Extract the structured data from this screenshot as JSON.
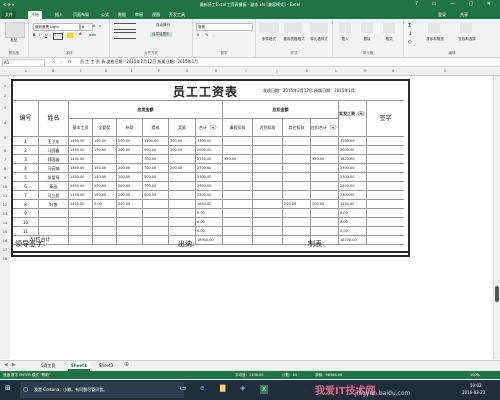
{
  "window": {
    "title": "最新员工Excel工资表模板 - 副本.xls [兼容模式] - Excel",
    "controls": "? ▭ — ▢ ✕"
  },
  "quick_access": "⟲ ⟳ ▾",
  "menu": {
    "tabs": [
      "文件",
      "开始",
      "插入",
      "页面布局",
      "公式",
      "数据",
      "审阅",
      "视图",
      "开发工具"
    ],
    "active": "开始",
    "right": [
      "登录",
      "共享"
    ]
  },
  "ribbon": {
    "clipboard": {
      "label": "剪贴板",
      "paste": "粘贴"
    },
    "font": {
      "label": "字体",
      "name": "微软雅黑 Light",
      "size": "8",
      "bold": "B",
      "italic": "I",
      "underline": "U",
      "grow": "A",
      "shrink": "A",
      "wen": "wén"
    },
    "align": {
      "label": "对齐方式",
      "wrap": "自动换行",
      "merge": "合并后居中"
    },
    "number": {
      "label": "数字",
      "format": "常规",
      "percent": "%",
      "comma": ","
    },
    "styles": {
      "label": "样式",
      "cond": "条件格式",
      "table": "套用表格格式",
      "cell": "单元格样式"
    },
    "cells": {
      "label": "单元格",
      "insert": "插入",
      "delete": "删除",
      "format": "格式"
    },
    "edit": {
      "label": "编辑",
      "sort": "排序和筛选",
      "find": "查找和选择"
    }
  },
  "formula_bar": {
    "name_box": "A1",
    "fx": "fx",
    "value": "员 工 工 资 表   发放日期：2015年2月12日  所属日期：2015年1月"
  },
  "columns": [
    "A",
    "B",
    "C",
    "D",
    "E",
    "F",
    "G",
    "H",
    "I",
    "J",
    "K",
    "L",
    "M",
    "N",
    "O"
  ],
  "rows": [
    "1",
    "2",
    "3",
    "4",
    "5",
    "6",
    "7",
    "8",
    "9",
    "10",
    "11",
    "12",
    "13",
    "14",
    "15",
    "16",
    "17",
    "18"
  ],
  "sheet": {
    "title": "员工工资表",
    "date_text": "发放日期：2015年2月12日 所属日期：2015年1月",
    "hdr_no": "编号",
    "hdr_name": "姓名",
    "hdr_payable": "应发金额",
    "hdr_deduct": "应扣金额",
    "hdr_actual": "实发工资（元）",
    "hdr_sign": "签字",
    "sub_payable": [
      "基本工资",
      "全勤奖",
      "补助",
      "提成",
      "奖励",
      "合计（元）"
    ],
    "sub_deduct": [
      "事假扣款",
      "迟到扣款",
      "其它扣款",
      "应扣合计（元）"
    ],
    "rows": [
      {
        "no": "1",
        "name": "王卫东",
        "v": [
          "1450.00",
          "150.00",
          "200.00",
          "1200.00",
          "300.00",
          "3300.00",
          "",
          "",
          "",
          "",
          "3300.00"
        ]
      },
      {
        "no": "2",
        "name": "马国鑫",
        "v": [
          "1450.00",
          "150.00",
          "200.00",
          "900.00",
          "300.00",
          "3000.00",
          "",
          "",
          "",
          "",
          "3000.00"
        ]
      },
      {
        "no": "3",
        "name": "郑国坡",
        "v": [
          "1450.00",
          "",
          "",
          "700.00",
          "",
          "2150.00",
          "330.00",
          "",
          "",
          "330.00",
          "1820.00"
        ]
      },
      {
        "no": "4",
        "name": "马云城",
        "v": [
          "1450.00",
          "150.00",
          "200.00",
          "700.00",
          "200.00",
          "2700.00",
          "",
          "",
          "",
          "",
          "2700.00"
        ]
      },
      {
        "no": "5",
        "name": "张爱琴",
        "v": [
          "1450.00",
          "150.00",
          "200.00",
          "500.00",
          "",
          "2300.00",
          "",
          "",
          "",
          "",
          "2300.00"
        ]
      },
      {
        "no": "6",
        "name": "秦函",
        "v": [
          "1450.00",
          "150.00",
          "200.00",
          "700.00",
          "",
          "2500.00",
          "",
          "",
          "",
          "",
          "2500.00"
        ]
      },
      {
        "no": "7",
        "name": "马立超",
        "v": [
          "1450.00",
          "150.00",
          "200.00",
          "500.00",
          "",
          "2300.00",
          "",
          "",
          "",
          "",
          "2300.00"
        ]
      },
      {
        "no": "8",
        "name": "叶睿",
        "v": [
          "1450.00",
          "0.00",
          "200.00",
          "",
          "",
          "1650.00",
          "",
          "",
          "200.00",
          "200.00",
          "1450.00"
        ]
      },
      {
        "no": "9",
        "name": "",
        "v": [
          "",
          "",
          "",
          "",
          "",
          "0.00",
          "",
          "",
          "",
          "",
          "0.00"
        ]
      },
      {
        "no": "10",
        "name": "",
        "v": [
          "",
          "",
          "",
          "",
          "",
          "0.00",
          "",
          "",
          "",
          "",
          "0.00"
        ]
      },
      {
        "no": "11",
        "name": "",
        "v": [
          "",
          "",
          "",
          "",
          "",
          "0.00",
          "",
          "",
          "",
          "",
          "0.00"
        ]
      }
    ],
    "total_label": "分栏合计",
    "total_sum": "18900.00",
    "total_actual": "18770.00",
    "footer_leader": "领导签字:",
    "footer_cashier": "出纳:",
    "footer_maker": "制表:"
  },
  "sheet_tabs": [
    "5月工资",
    "Sheet1",
    "Sheet3"
  ],
  "active_sheet": "Sheet1",
  "status": {
    "left": "就绪  数字  ENTER  模式 \"帮助\"",
    "avg": "平均值：1136.00",
    "count": "计数：44",
    "sum": "求和：96566.00",
    "zoom": "100%"
  },
  "taskbar": {
    "search": "我是 Cortana，小娜。有问题尽管问我。",
    "time": "10:02",
    "date": "2016-03-23",
    "watermark": "我爱IT技术网",
    "watermark_url": "jingyan.baidu.com"
  },
  "colors": {
    "accent": "#217346",
    "grid": "#999999",
    "border": "#2a2a2a"
  }
}
